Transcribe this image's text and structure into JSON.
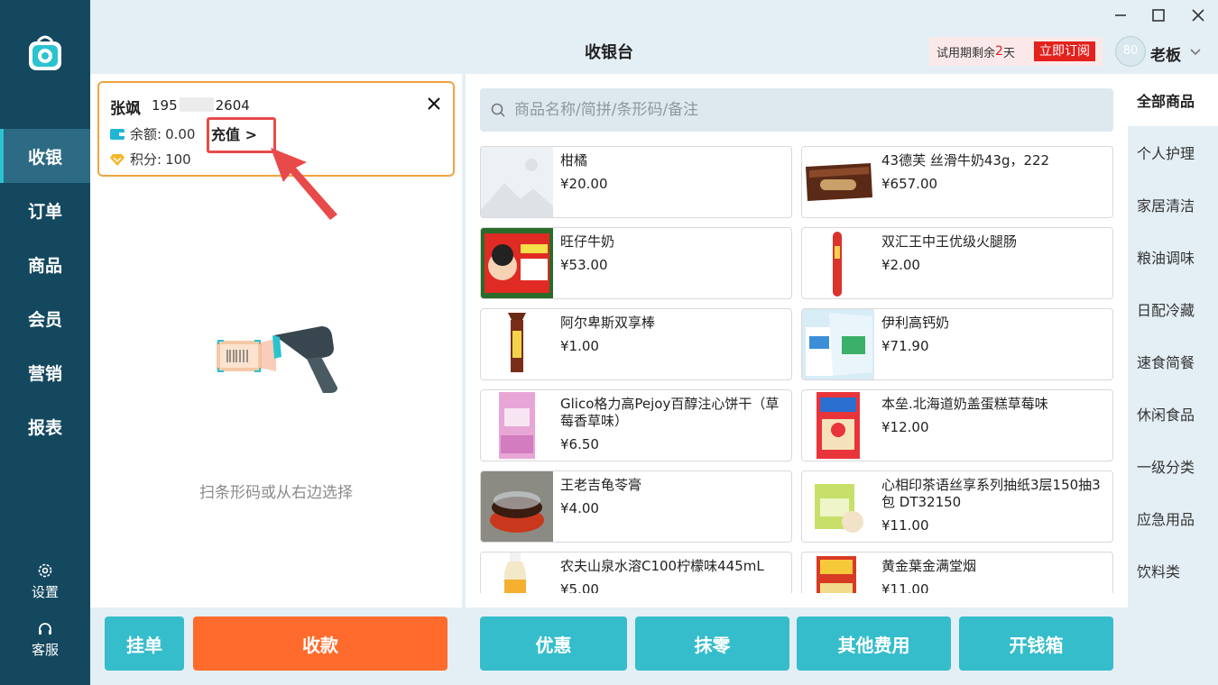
{
  "app": {
    "title": "收银台"
  },
  "nav": {
    "items": [
      {
        "label": "收银",
        "active": true
      },
      {
        "label": "订单"
      },
      {
        "label": "商品"
      },
      {
        "label": "会员"
      },
      {
        "label": "营销"
      },
      {
        "label": "报表"
      }
    ],
    "settings_label": "设置",
    "service_label": "客服"
  },
  "header": {
    "trial_prefix": "试用期剩余",
    "trial_days": "2",
    "trial_suffix": "天",
    "subscribe_label": "立即订阅",
    "avatar_text": "80",
    "user_name": "老板"
  },
  "member": {
    "name": "张飒",
    "phone_prefix": "195",
    "phone_suffix": "2604",
    "balance_label": "余额:",
    "balance_value": "0.00",
    "recharge_label": "充值 >",
    "points_label": "积分:",
    "points_value": "100"
  },
  "cart": {
    "empty_hint": "扫条形码或从右边选择"
  },
  "search": {
    "placeholder": "商品名称/简拼/条形码/备注"
  },
  "products": [
    {
      "name": "柑橘",
      "price": "¥20.00",
      "image": "placeholder"
    },
    {
      "name": "43德芙 丝滑牛奶43g，222",
      "price": "¥657.00",
      "image": "dove"
    },
    {
      "name": "旺仔牛奶",
      "price": "¥53.00",
      "image": "wangzai"
    },
    {
      "name": "双汇王中王优级火腿肠",
      "price": "¥2.00",
      "image": "sausage"
    },
    {
      "name": "阿尔卑斯双享棒",
      "price": "¥1.00",
      "image": "lollipop"
    },
    {
      "name": "伊利高钙奶",
      "price": "¥71.90",
      "image": "milk-box"
    },
    {
      "name": "Glico格力高Pejoy百醇注心饼干（草莓香草味）",
      "price": "¥6.50",
      "image": "pejoy"
    },
    {
      "name": "本垒.北海道奶盖蛋糕草莓味",
      "price": "¥12.00",
      "image": "cake"
    },
    {
      "name": "王老吉龟苓膏",
      "price": "¥4.00",
      "image": "jelly"
    },
    {
      "name": "心相印茶语丝享系列抽纸3层150抽3包 DT32150",
      "price": "¥11.00",
      "image": "tissue"
    },
    {
      "name": "农夫山泉水溶C100柠檬味445mL",
      "price": "¥5.00",
      "image": "bottle"
    },
    {
      "name": "黄金葉金满堂烟",
      "price": "¥11.00",
      "image": "cigarette"
    }
  ],
  "categories": [
    {
      "label": "全部商品",
      "active": true
    },
    {
      "label": "个人护理"
    },
    {
      "label": "家居清洁"
    },
    {
      "label": "粮油调味"
    },
    {
      "label": "日配冷藏"
    },
    {
      "label": "速食简餐"
    },
    {
      "label": "休闲食品"
    },
    {
      "label": "一级分类"
    },
    {
      "label": "应急用品"
    },
    {
      "label": "饮料类"
    }
  ],
  "actions": {
    "hold_label": "挂单",
    "checkout_label": "收款",
    "discount_label": "优惠",
    "round_label": "抹零",
    "other_fee_label": "其他费用",
    "cash_drawer_label": "开钱箱"
  },
  "colors": {
    "nav_bg": "#14485f",
    "accent_teal": "#35bdcb",
    "checkout_orange": "#ff6b2c",
    "member_border": "#f0a441",
    "subscribe_red": "#e3221d"
  }
}
